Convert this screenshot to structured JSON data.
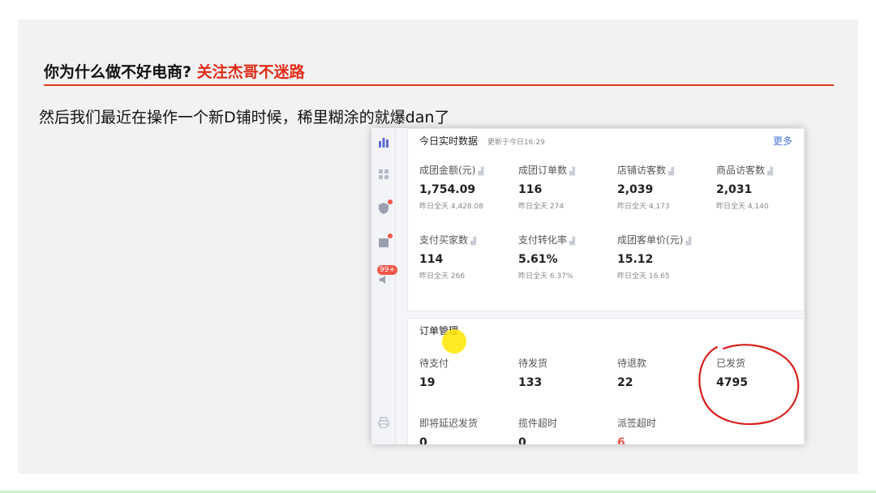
{
  "slide": {
    "title": "你为什么做不好电商?",
    "title_accent": "关注杰哥不迷路",
    "text": "然后我们最近在操作一个新D铺时候，稀里糊涂的就爆dan了",
    "accent_color": "#e02c18"
  },
  "realtime": {
    "title": "今日实时数据",
    "updated": "更新于今日16:29",
    "more": "更多",
    "stats": [
      {
        "label": "成团金额(元)",
        "value": "1,754.09",
        "sub": "昨日全天 4,428.08"
      },
      {
        "label": "成团订单数",
        "value": "116",
        "sub": "昨日全天 274"
      },
      {
        "label": "店铺访客数",
        "value": "2,039",
        "sub": "昨日全天 4,173"
      },
      {
        "label": "商品访客数",
        "value": "2,031",
        "sub": "昨日全天 4,140"
      },
      {
        "label": "支付买家数",
        "value": "114",
        "sub": "昨日全天 266"
      },
      {
        "label": "支付转化率",
        "value": "5.61%",
        "sub": "昨日全天 6.37%"
      },
      {
        "label": "成团客单价(元)",
        "value": "15.12",
        "sub": "昨日全天 16.65"
      }
    ]
  },
  "orders": {
    "title": "订单管理",
    "items": [
      {
        "label": "待支付",
        "value": "19"
      },
      {
        "label": "待发货",
        "value": "133"
      },
      {
        "label": "待退款",
        "value": "22"
      },
      {
        "label": "已发货",
        "value": "4795"
      },
      {
        "label": "即将延迟发货",
        "value": "0"
      },
      {
        "label": "揽件超时",
        "value": "0"
      },
      {
        "label": "派签超时",
        "value": "6"
      }
    ]
  },
  "rail": {
    "badge": "99+",
    "icons": [
      "bar-chart-icon",
      "apps-grid-icon",
      "shield-icon",
      "store-icon",
      "speaker-icon",
      "printer-icon"
    ]
  }
}
